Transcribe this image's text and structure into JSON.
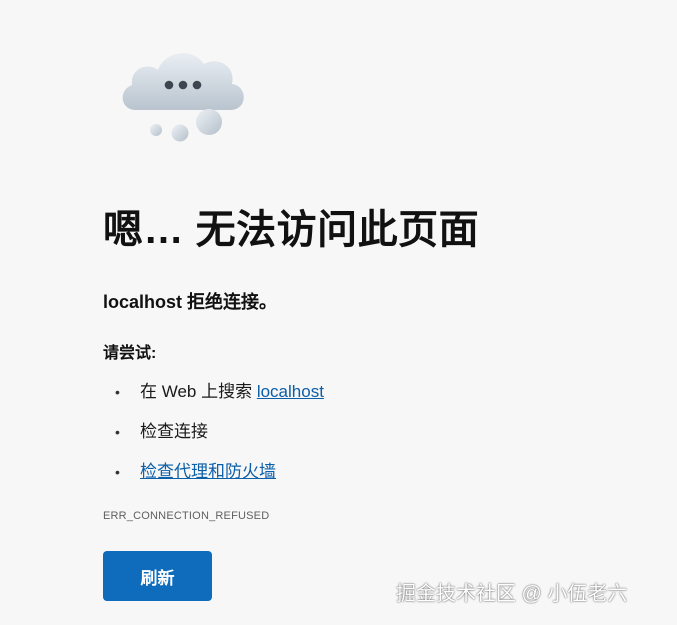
{
  "illustration": {
    "icon": "cloud-with-dots-icon"
  },
  "error": {
    "title": "嗯… 无法访问此页面",
    "host": "localhost",
    "message_suffix": " 拒绝连接。",
    "try_heading": "请尝试:",
    "suggestions": [
      {
        "prefix": "在 Web 上搜索 ",
        "link": "localhost"
      },
      {
        "text": "检查连接"
      },
      {
        "link": "检查代理和防火墙"
      }
    ],
    "code": "ERR_CONNECTION_REFUSED"
  },
  "actions": {
    "refresh_label": "刷新"
  },
  "watermark": {
    "text": "掘金技术社区 @ 小伍老六"
  },
  "colors": {
    "background": "#f7f7f7",
    "accent": "#0f6cbd",
    "link": "#0b5ea8"
  }
}
